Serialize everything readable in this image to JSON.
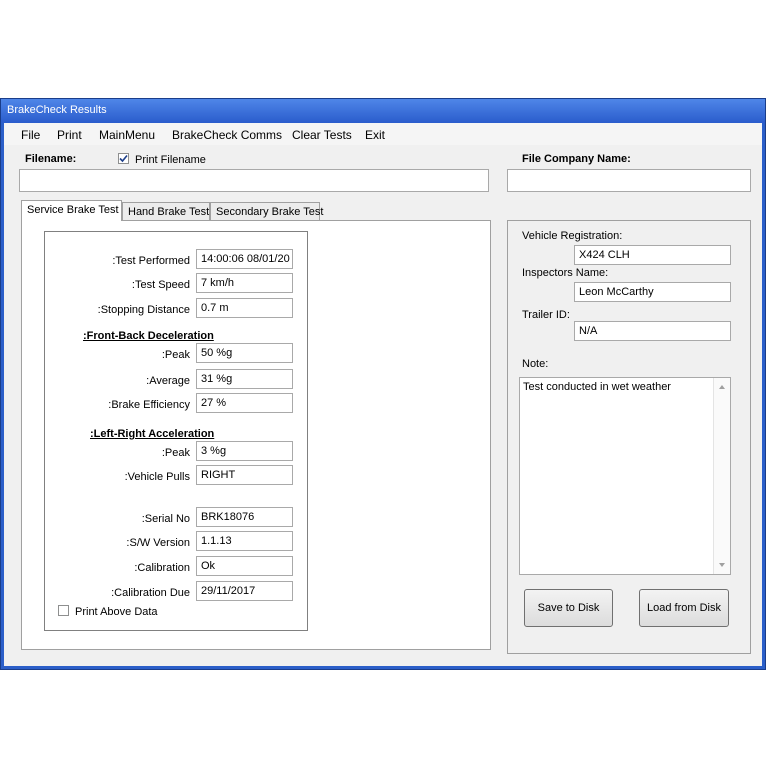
{
  "window": {
    "title": "BrakeCheck Results"
  },
  "menu": [
    "File",
    "Print",
    "MainMenu",
    "BrakeCheck Comms",
    "Clear Tests",
    "Exit"
  ],
  "header": {
    "filename_label": "Filename:",
    "print_filename_label": "Print Filename",
    "print_filename_checked": true,
    "filename_value": "",
    "company_label": "File Company Name:",
    "company_value": ""
  },
  "tabs": [
    "Service Brake Test",
    "Hand Brake Test",
    "Secondary Brake Test"
  ],
  "test": {
    "test_performed_label": ":Test Performed",
    "test_performed_value": "14:00:06 08/01/20",
    "test_speed_label": ":Test Speed",
    "test_speed_value": "7 km/h",
    "stopping_distance_label": ":Stopping Distance",
    "stopping_distance_value": "0.7 m",
    "fb_heading": ":Front-Back Deceleration",
    "fb_peak_label": ":Peak",
    "fb_peak_value": "50 %g",
    "average_label": ":Average",
    "average_value": "31 %g",
    "brake_eff_label": ":Brake Efficiency",
    "brake_eff_value": "27 %",
    "lr_heading": ":Left-Right Acceleration",
    "lr_peak_label": ":Peak",
    "lr_peak_value": "3 %g",
    "pulls_label": ":Vehicle Pulls",
    "pulls_value": "RIGHT",
    "serial_label": ":Serial No",
    "serial_value": "BRK18076",
    "sw_label": ":S/W Version",
    "sw_value": "1.1.13",
    "cal_label": ":Calibration",
    "cal_value": "Ok",
    "cal_due_label": ":Calibration Due",
    "cal_due_value": "29/11/2017",
    "print_above_label": "Print Above Data",
    "print_above_checked": false
  },
  "vehicle": {
    "reg_label": "Vehicle Registration:",
    "reg_value": "X424 CLH",
    "inspector_label": "Inspectors Name:",
    "inspector_value": "Leon McCarthy",
    "trailer_label": "Trailer ID:",
    "trailer_value": "N/A",
    "note_label": "Note:",
    "note_value": "Test conducted in wet weather",
    "save_label": "Save to Disk",
    "load_label": "Load from Disk"
  },
  "icons": {
    "check": "checkmark-icon",
    "scroll_up": "scroll-up-arrow-icon",
    "scroll_down": "scroll-down-arrow-icon"
  }
}
